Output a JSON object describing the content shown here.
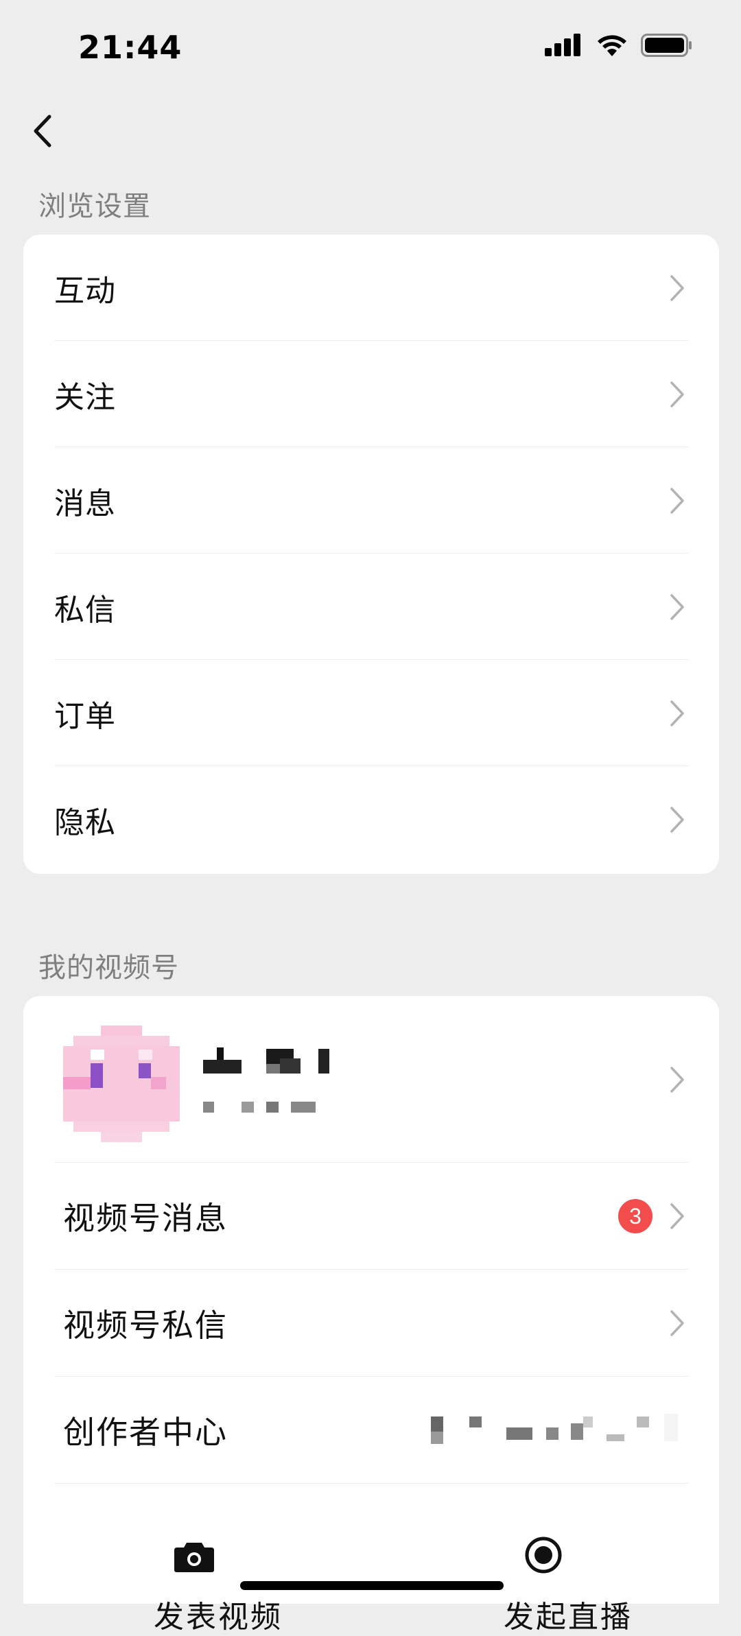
{
  "status_bar": {
    "time": "21:44",
    "icons": [
      "signal-icon",
      "wifi-icon",
      "battery-icon"
    ]
  },
  "nav": {
    "back_icon": "chevron-left-icon"
  },
  "browse_section": {
    "title": "浏览设置",
    "items": [
      {
        "label": "互动"
      },
      {
        "label": "关注"
      },
      {
        "label": "消息"
      },
      {
        "label": "私信"
      },
      {
        "label": "订单"
      },
      {
        "label": "隐私"
      }
    ]
  },
  "channels_section": {
    "title": "我的视频号",
    "items": [
      {
        "label": "视频号消息",
        "badge": "3"
      },
      {
        "label": "视频号私信"
      },
      {
        "label": "创作者中心"
      }
    ]
  },
  "bottom_actions": {
    "publish_video_icon": "camera-icon",
    "start_live_icon": "record-icon",
    "publish_video_label": "发表视频",
    "start_live_label": "发起直播"
  },
  "colors": {
    "background": "#ededed",
    "card": "#ffffff",
    "badge": "#f24c4c",
    "section_title": "#7f7f7f"
  }
}
